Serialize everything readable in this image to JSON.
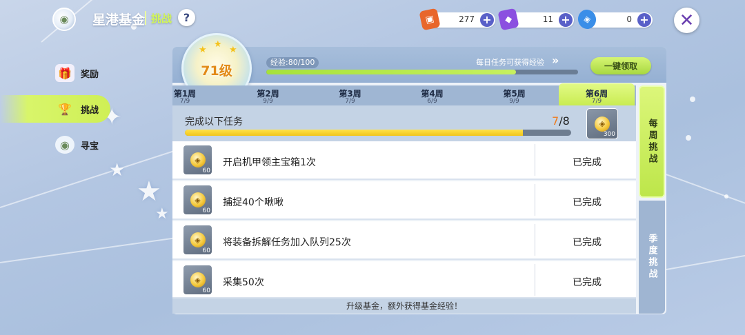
{
  "header": {
    "title": "星港基金",
    "subtitle": "挑战",
    "help_label": "?",
    "close_label": "✕"
  },
  "resources": [
    {
      "name": "card-ticket",
      "value": "277",
      "color": "#e8662b"
    },
    {
      "name": "purple-ticket",
      "value": "11",
      "color": "#8b4fe0"
    },
    {
      "name": "blue-crystal",
      "value": "0",
      "color": "#3a8ee8"
    }
  ],
  "sidebar": {
    "items": [
      {
        "label": "奖励",
        "icon": "gift-icon"
      },
      {
        "label": "挑战",
        "icon": "trophy-icon",
        "active": true
      },
      {
        "label": "寻宝",
        "icon": "treasure-icon"
      }
    ]
  },
  "level": {
    "label": "71级",
    "exp_label": "经验:80/100",
    "exp_progress": 0.8,
    "daily_hint": "每日任务可获得经验",
    "claim_all_label": "一键领取"
  },
  "weeks": [
    {
      "label": "第1周",
      "count": "7/9"
    },
    {
      "label": "第2周",
      "count": "9/9"
    },
    {
      "label": "第3周",
      "count": "7/9"
    },
    {
      "label": "第4周",
      "count": "6/9"
    },
    {
      "label": "第5周",
      "count": "9/9"
    },
    {
      "label": "第6周",
      "count": "7/9",
      "active": true
    }
  ],
  "summary": {
    "title": "完成以下任务",
    "done": "7",
    "total": "/8",
    "progress": 0.875,
    "reward_amount": "300"
  },
  "tasks": [
    {
      "name": "开启机甲领主宝箱1次",
      "reward": "60",
      "status": "已完成"
    },
    {
      "name": "捕捉40个啾啾",
      "reward": "60",
      "status": "已完成"
    },
    {
      "name": "将装备拆解任务加入队列25次",
      "reward": "60",
      "status": "已完成"
    },
    {
      "name": "采集50次",
      "reward": "60",
      "status": "已完成"
    }
  ],
  "footer_note": "升级基金，额外获得基金经验！",
  "side_tabs": {
    "weekly": "每周挑战",
    "season": "季度挑战"
  },
  "colors": {
    "accent_green": "#cfef55",
    "progress_yellow": "#f1c51a",
    "highlight_orange": "#f07a1a",
    "plus_button": "#5960c8"
  }
}
